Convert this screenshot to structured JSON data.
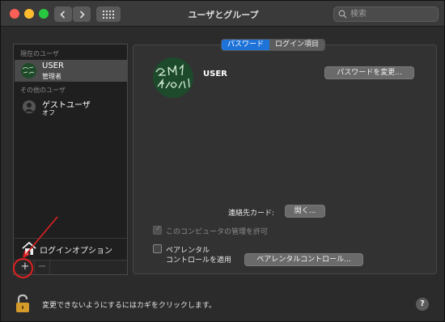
{
  "window": {
    "title": "ユーザとグループ"
  },
  "toolbar": {
    "search_placeholder": "検索"
  },
  "sidebar": {
    "current_user_header": "現在のユーザ",
    "current_user": {
      "name": "USER",
      "role": "管理者"
    },
    "other_users_header": "その他のユーザ",
    "guest_user": {
      "name": "ゲストユーザ",
      "status": "オフ"
    },
    "login_options_label": "ログインオプション",
    "add_label": "+",
    "remove_label": "−"
  },
  "tabs": [
    {
      "label": "パスワード",
      "active": true
    },
    {
      "label": "ログイン項目",
      "active": false
    }
  ],
  "main": {
    "user_name": "USER",
    "change_password_label": "パスワードを変更...",
    "contact_card_label": "連絡先カード:",
    "open_label": "開く...",
    "allow_admin_label": "このコンピュータの管理を許可",
    "allow_admin_checked": true,
    "allow_admin_enabled": false,
    "parental_label_line1": "ペアレンタル",
    "parental_label_line2": "コントロールを適用",
    "parental_checked": false,
    "parental_button_label": "ペアレンタルコントロール..."
  },
  "footer": {
    "lock_text": "変更できないようにするにはカギをクリックします。",
    "help_label": "?"
  },
  "colors": {
    "accent": "#1e73d8",
    "annotation": "#e02020"
  },
  "icons": {
    "back": "chevron-left-icon",
    "forward": "chevron-right-icon",
    "grid": "grid-icon",
    "search": "search-icon",
    "lock": "lock-icon",
    "home": "house-icon",
    "guest": "person-icon"
  }
}
